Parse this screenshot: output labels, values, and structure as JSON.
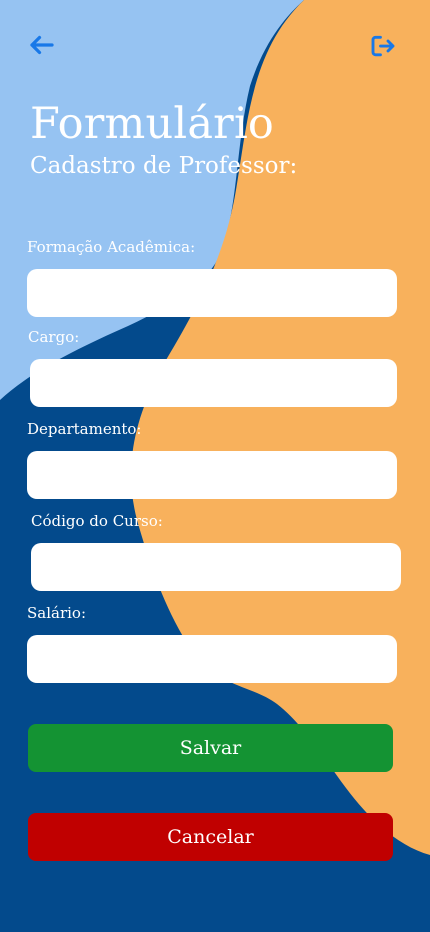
{
  "header": {
    "back_icon": "arrow-left-icon",
    "exit_icon": "log-out-icon",
    "title": "Formulário",
    "subtitle": "Cadastro de Professor:"
  },
  "form": {
    "fields": [
      {
        "label": "Formação Acadêmica:",
        "value": "",
        "placeholder": ""
      },
      {
        "label": "Cargo:",
        "value": "",
        "placeholder": ""
      },
      {
        "label": "Departamento:",
        "value": "",
        "placeholder": ""
      },
      {
        "label": "Código do Curso:",
        "value": "",
        "placeholder": ""
      },
      {
        "label": "Salário:",
        "value": "",
        "placeholder": ""
      }
    ],
    "save_label": "Salvar",
    "cancel_label": "Cancelar"
  },
  "colors": {
    "background_dark_blue": "#034a8c",
    "background_light_blue": "#96c3f2",
    "background_orange": "#f8b15c",
    "icon_blue": "#1878e8",
    "save_green": "#149333",
    "cancel_red": "#c00000"
  }
}
